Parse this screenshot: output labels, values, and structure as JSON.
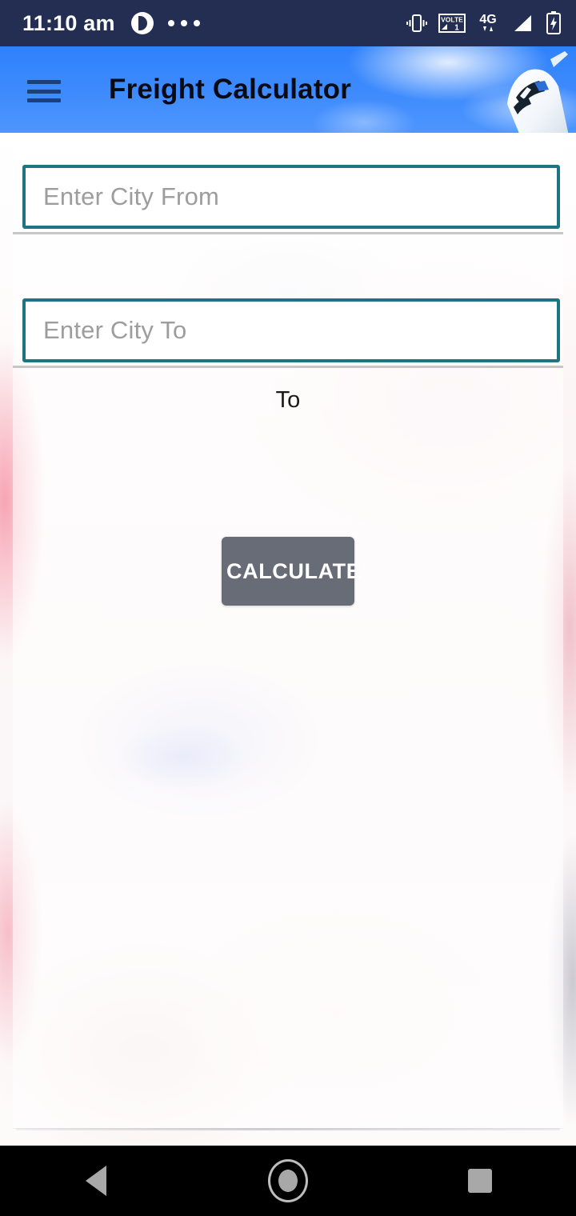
{
  "status_bar": {
    "time": "11:10 am",
    "notification_icon": "app-notification-icon",
    "overflow_icon": "more-notifications-dots",
    "right_icons": [
      {
        "name": "vibrate-icon",
        "label": "vibrate"
      },
      {
        "name": "volte-icon",
        "label": "VOLTE"
      },
      {
        "name": "network-4g-icon",
        "label": "4G"
      },
      {
        "name": "signal-strength-icon",
        "label": "signal"
      },
      {
        "name": "battery-charging-icon",
        "label": "battery charging"
      }
    ],
    "background_color": "#232e52",
    "text_color": "#ffffff"
  },
  "app_bar": {
    "title": "Freight Calculator",
    "menu_icon": "hamburger-menu-icon",
    "hero_image": "airplane-in-blue-sky",
    "background_color": "#3e8bfd",
    "title_color": "#0a0a12"
  },
  "form": {
    "city_from": {
      "placeholder": "Enter City From",
      "value": ""
    },
    "separator_label": "To",
    "city_to": {
      "placeholder": "Enter City To",
      "value": ""
    },
    "calculate_label": "CALCULATE",
    "field_border_color": "#1d7483",
    "button_color": "#686c76",
    "placeholder_color": "#9d9d9d"
  },
  "nav_bar": {
    "back_label": "Back",
    "home_label": "Home",
    "recents_label": "Recents",
    "background_color": "#000000",
    "icon_color": "#a8a8a8"
  }
}
